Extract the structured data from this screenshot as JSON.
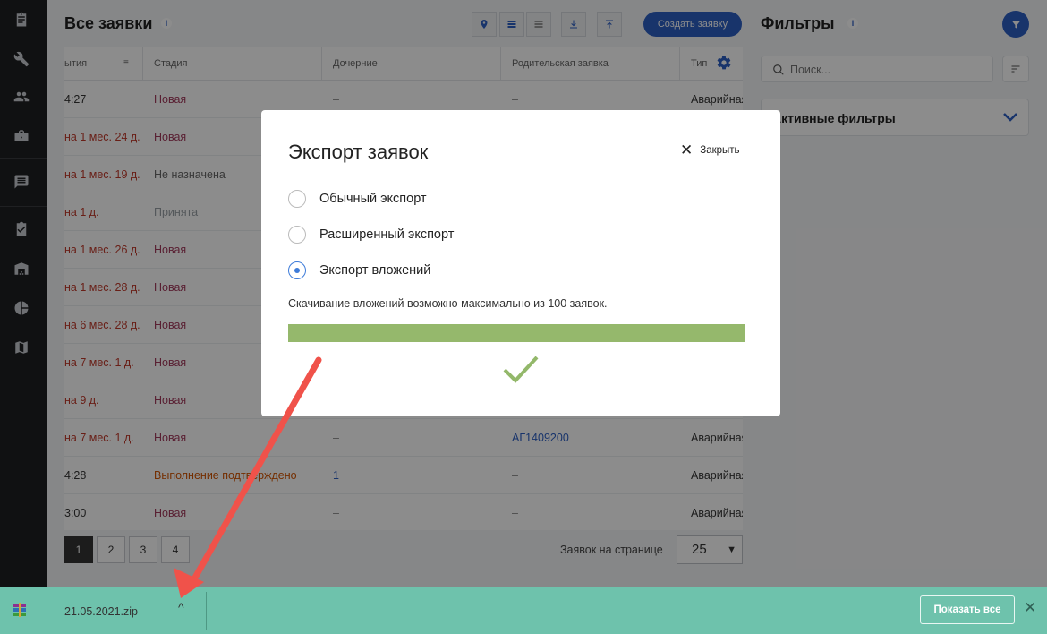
{
  "sidebar": {
    "icons": [
      "clipboard-icon",
      "wrench-icon",
      "users-icon",
      "briefcase-icon",
      "chat-icon",
      "checklist-icon",
      "warehouse-icon",
      "pie-chart-icon",
      "map-icon"
    ]
  },
  "header": {
    "title": "Все заявки",
    "info": "i",
    "create_label": "Создать заявку"
  },
  "table": {
    "columns": [
      "ытия",
      "Стадия",
      "Дочерние",
      "Родительская заявка",
      "Тип"
    ],
    "rows": [
      {
        "time": "4:27",
        "stage": "Новая",
        "children": "–",
        "parent": "–",
        "type": "Аварийная"
      },
      {
        "time": "на 1 мес. 24 д.",
        "stage": "Новая",
        "children": "",
        "parent": "",
        "type": ""
      },
      {
        "time": "на 1 мес. 19 д.",
        "stage": "Не назначена",
        "children": "",
        "parent": "",
        "type": ""
      },
      {
        "time": "на 1 д.",
        "stage": "Принята",
        "children": "",
        "parent": "",
        "type": ""
      },
      {
        "time": "на 1 мес. 26 д.",
        "stage": "Новая",
        "children": "",
        "parent": "",
        "type": ""
      },
      {
        "time": "на 1 мес. 28 д.",
        "stage": "Новая",
        "children": "",
        "parent": "",
        "type": ""
      },
      {
        "time": "на 6 мес. 28 д.",
        "stage": "Новая",
        "children": "",
        "parent": "",
        "type": ""
      },
      {
        "time": "на 7 мес. 1 д.",
        "stage": "Новая",
        "children": "",
        "parent": "",
        "type": ""
      },
      {
        "time": "на 9 д.",
        "stage": "Новая",
        "children": "",
        "parent": "",
        "type": ""
      },
      {
        "time": "на 7 мес. 1 д.",
        "stage": "Новая",
        "children": "–",
        "parent": "АГ1409200",
        "type": "Аварийная"
      },
      {
        "time": "4:28",
        "stage": "Выполнение подтверждено",
        "children": "1",
        "parent": "–",
        "type": "Аварийная"
      },
      {
        "time": "3:00",
        "stage": "Новая",
        "children": "–",
        "parent": "–",
        "type": "Аварийная"
      }
    ]
  },
  "pagination": {
    "pages": [
      "1",
      "2",
      "3",
      "4"
    ],
    "per_page_label": "Заявок на странице",
    "per_page_value": "25"
  },
  "filters": {
    "title": "Фильтры",
    "info": "i",
    "search_placeholder": "Поиск...",
    "active_filters_label": "Активные фильтры"
  },
  "modal": {
    "title": "Экспорт заявок",
    "close_label": "Закрыть",
    "options": [
      {
        "label": "Обычный экспорт",
        "checked": false
      },
      {
        "label": "Расширенный экспорт",
        "checked": false
      },
      {
        "label": "Экспорт вложений",
        "checked": true
      }
    ],
    "note": "Скачивание вложений возможно максимально из 100 заявок.",
    "progress": 1.0
  },
  "download_bar": {
    "filename": "21.05.2021.zip",
    "caret": "^",
    "show_all_label": "Показать все",
    "close": "✕"
  },
  "colors": {
    "accent": "#2d5fc4",
    "progress": "#95b86c",
    "download_bar": "#6ec2ac",
    "stage_new": "#a33a5c",
    "time_overdue": "#c0392b",
    "stage_done": "#d35400",
    "link": "#2d5fc4"
  }
}
